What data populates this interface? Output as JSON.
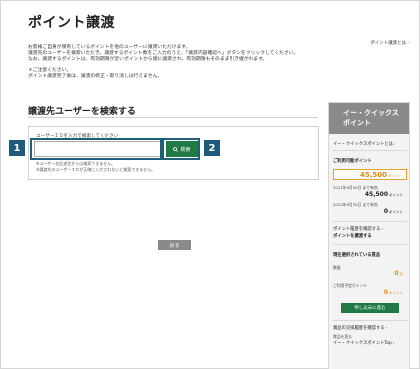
{
  "page": {
    "title": "ポイント譲渡",
    "help_link": "ポイント譲渡とは",
    "intro_lines": [
      "お客様ご自身が保有しているポイントを他のユーザーに譲渡いただけます。",
      "譲渡先のユーザーを検索いただき、譲渡するポイント数をご入力のうえ、「譲渡内容確認へ」ボタンをクリックしてください。",
      "なお、譲渡するポイントは、有効期限が近いポイントから順に譲渡され、有効期限もそのまま引き継がれます。",
      "＊ご注意ください。",
      "ポイント譲渡完了後は、譲渡の修正・取り消しは行えません。"
    ]
  },
  "search": {
    "section_title": "譲渡先ユーザーを検索する",
    "label": "ユーザーＩＤを入力で検索してください",
    "input_value": "",
    "button_label": "検索",
    "notes": [
      "※ユーザー名記述名からは検索できません。",
      "※譲渡先のユーザーＩＤが正確に入力されないと検索できません。"
    ]
  },
  "markers": [
    "1",
    "2"
  ],
  "back_button": "戻る",
  "sidebar": {
    "title_line1": "イー・クイックス",
    "title_line2": "ポイント",
    "about_link": "イー・クイックスポイントとは",
    "available_label": "ご利用可能ポイント",
    "available_value": "45,500",
    "unit": "ポイント",
    "expiry1_label": "2021年9月30日 まで有効",
    "expiry1_value": "45,500",
    "expiry2_label": "2022年9月30日 まで有効",
    "expiry2_value": "0",
    "history_link": "ポイント履歴を確認する",
    "transfer_link": "ポイントを譲渡する",
    "selected_label": "現在選択されている賞品",
    "count_label": "数量",
    "count_value": "0",
    "count_unit": "点",
    "planned_label": "ご利用予定ポイント",
    "planned_value": "0",
    "apply_button": "申し込みに進む",
    "exchange_history_link": "賞品の交換履歴を確認する",
    "gift_label": "賞品を見る",
    "top_link": "イー・クイックスポイントTop"
  },
  "colors": {
    "brand_green": "#1f7a46",
    "accent_orange": "#e08a14",
    "marker_blue": "#1f5a7a"
  }
}
